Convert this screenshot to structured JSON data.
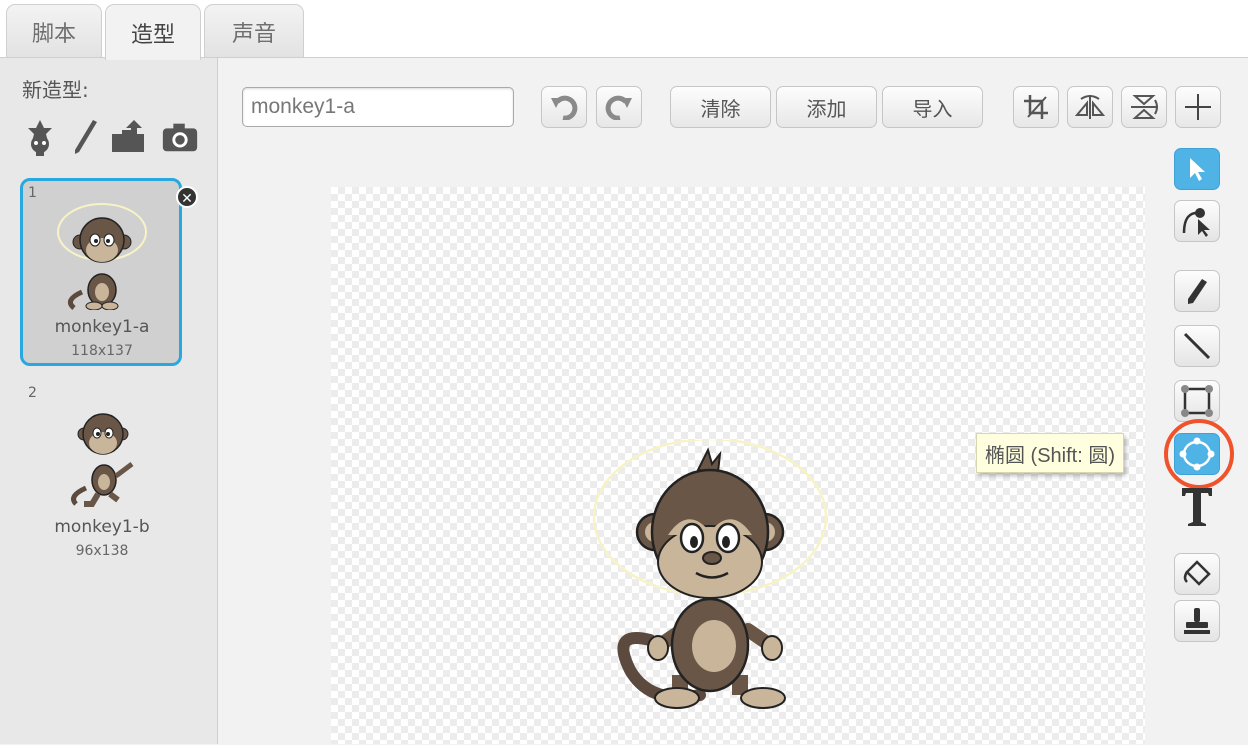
{
  "tabs": [
    {
      "label": "脚本"
    },
    {
      "label": "造型"
    },
    {
      "label": "声音"
    }
  ],
  "left_panel": {
    "new_costume_label": "新造型:",
    "new_costume_icons": [
      "sprite-library-icon",
      "paint-brush-icon",
      "upload-icon",
      "camera-icon"
    ],
    "costumes": [
      {
        "number": "1",
        "name": "monkey1-a",
        "size": "118x137",
        "selected": true
      },
      {
        "number": "2",
        "name": "monkey1-b",
        "size": "96x138",
        "selected": false
      }
    ],
    "delete_glyph": "✕"
  },
  "editor": {
    "costume_name_value": "monkey1-a",
    "toolbar": {
      "clear_label": "清除",
      "add_label": "添加",
      "import_label": "导入"
    },
    "tools": [
      "select",
      "reshape",
      "pencil",
      "line",
      "rectangle",
      "ellipse",
      "text",
      "fill",
      "stamp"
    ],
    "selected_tool": "select",
    "tooltip": "椭圆 (Shift:  圆)",
    "accent_color": "#4fb3e6",
    "highlight_color": "#f0532c"
  }
}
